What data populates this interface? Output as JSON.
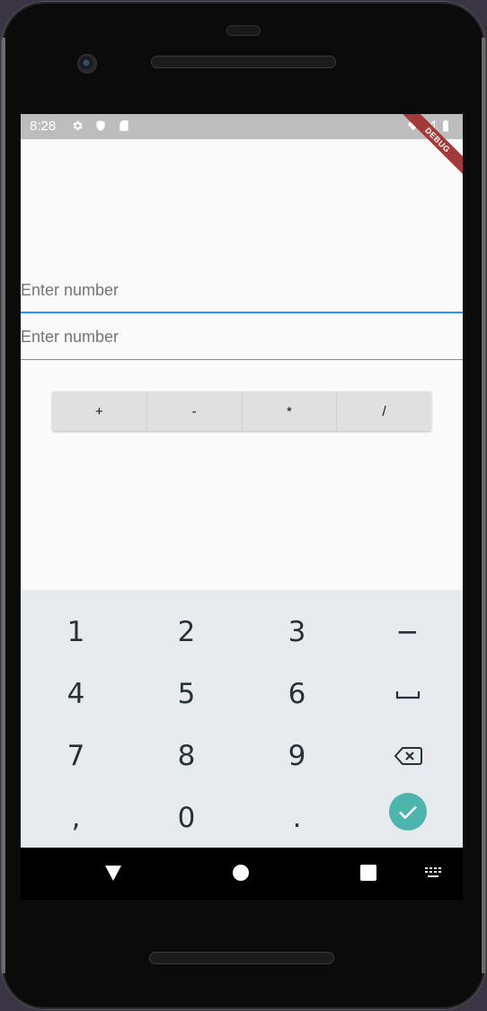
{
  "status_bar": {
    "time": "8:28",
    "icons": [
      "settings-icon",
      "shield-icon",
      "sd-card-icon",
      "wifi-icon",
      "signal-icon",
      "battery-icon"
    ],
    "debug_banner": "DEBUG",
    "bg_color": "#bdbdbd"
  },
  "form": {
    "first_number": {
      "placeholder": "Enter number",
      "value": "",
      "focused": true
    },
    "second_number": {
      "placeholder": "Enter number",
      "value": ""
    }
  },
  "operations": {
    "add": "+",
    "subtract": "-",
    "multiply": "*",
    "divide": "/"
  },
  "keyboard": {
    "k1": "1",
    "k2": "2",
    "k3": "3",
    "minus": "−",
    "k4": "4",
    "k5": "5",
    "k6": "6",
    "space_icon": "space-icon",
    "k7": "7",
    "k8": "8",
    "k9": "9",
    "backspace_icon": "backspace-icon",
    "comma": ",",
    "k0": "0",
    "period": ".",
    "done_icon": "check-icon",
    "accent_color": "#4db6ac"
  },
  "nav_bar": {
    "icons": [
      "back-icon",
      "home-icon",
      "recents-icon",
      "keyboard-switch-icon"
    ]
  },
  "colors": {
    "focus_underline": "#2196f3",
    "screen_bg": "#fafafa",
    "keyboard_bg": "#e8ebee"
  }
}
